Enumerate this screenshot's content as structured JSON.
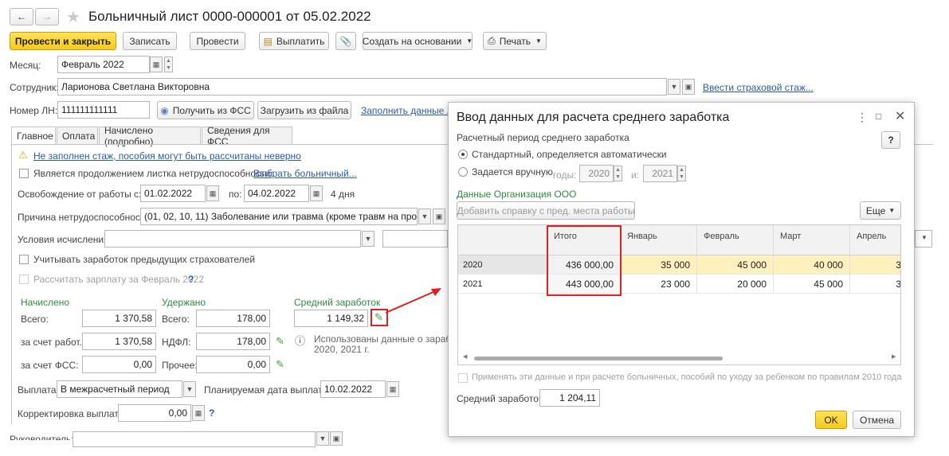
{
  "window": {
    "title": "Больничный лист 0000-000001 от 05.02.2022"
  },
  "toolbar": {
    "post_close": "Провести и закрыть",
    "save": "Записать",
    "post": "Провести",
    "pay": "Выплатить",
    "create_based": "Создать на основании",
    "print": "Печать"
  },
  "form": {
    "month_label": "Месяц:",
    "month_value": "Февраль 2022",
    "employee_label": "Сотрудник:",
    "employee_value": "Ларионова Светлана Викторовна",
    "insurance_link": "Ввести страховой стаж...",
    "ln_label": "Номер ЛН:",
    "ln_value": "111111111111",
    "get_fss": "Получить из ФСС",
    "load_file": "Загрузить из файла",
    "fill_link": "Заполнить данные лис"
  },
  "tabs": [
    "Главное",
    "Оплата",
    "Начислено (подробно)",
    "Сведения для ФСС"
  ],
  "main": {
    "warning": "Не заполнен стаж, пособия могут быть рассчитаны неверно",
    "continuation_label": "Является продолжением листка нетрудоспособности:",
    "choose_link": "Выбрать больничный...",
    "release_label": "Освобождение от работы с:",
    "release_from": "01.02.2022",
    "release_to_label": "по:",
    "release_to": "04.02.2022",
    "days": "4 дня",
    "reason_label": "Причина нетрудоспособности:",
    "reason_value": "(01, 02, 10, 11) Заболевание или травма (кроме травм на производст",
    "conditions_label": "Условия исчисления:",
    "prev_insurers": "Учитывать заработок предыдущих страхователей",
    "calc_salary": "Рассчитать зарплату за Февраль 2022",
    "help_q": "?",
    "accrued_title": "Начислено",
    "withheld_title": "Удержано",
    "avg_title": "Средний заработок",
    "total_label": "Всего:",
    "accrued_total": "1 370,58",
    "withheld_total_label": "Всего:",
    "withheld_total": "178,00",
    "avg_value": "1 149,32",
    "employer_label": "за счет работ.:",
    "employer_value": "1 370,58",
    "ndfl_label": "НДФЛ:",
    "ndfl_value": "178,00",
    "info_text_1": "Использованы данные о заработке",
    "info_text_2": "2020,  2021 г.",
    "fss_label": "за счет ФСС:",
    "fss_value": "0,00",
    "other_label": "Прочее:",
    "other_value": "0,00",
    "payment_label": "Выплата:",
    "payment_value": "В межрасчетный период",
    "planned_date_label": "Планируемая дата выплаты:",
    "planned_date": "10.02.2022",
    "correction_label": "Корректировка выплаты:",
    "correction_value": "0,00",
    "manager_label": "Руководитель:"
  },
  "dialog": {
    "title": "Ввод данных для расчета среднего заработка",
    "period_label": "Расчетный период среднего заработка",
    "opt_standard": "Стандартный, определяется автоматически",
    "opt_manual": "Задается вручную",
    "years_label": "годы:",
    "year_from": "2020",
    "and_label": "и:",
    "year_to": "2021",
    "org_label": "Данные Организация ООО",
    "add_certificate": "Добавить справку с пред. места работы",
    "more": "Еще",
    "help": "?",
    "columns": [
      "",
      "Итого",
      "Январь",
      "Февраль",
      "Март",
      "Апрель"
    ],
    "rows": [
      {
        "year": "2020",
        "total": "436 000,00",
        "jan": "35 000",
        "feb": "45 000",
        "mar": "40 000",
        "apr": "3"
      },
      {
        "year": "2021",
        "total": "443 000,00",
        "jan": "23 000",
        "feb": "20 000",
        "mar": "45 000",
        "apr": "3"
      }
    ],
    "apply_label": "Применять эти данные и при расчете больничных, пособий по уходу за ребенком по правилам 2010 года",
    "avg_label": "Средний заработок:",
    "avg_value": "1 204,11",
    "ok": "OK",
    "cancel": "Отмена"
  },
  "colors": {
    "accent_yellow": "#f7cb1c",
    "link_blue": "#2b5ca8",
    "green_label": "#2e8b3d",
    "highlight_red": "#e02020"
  }
}
